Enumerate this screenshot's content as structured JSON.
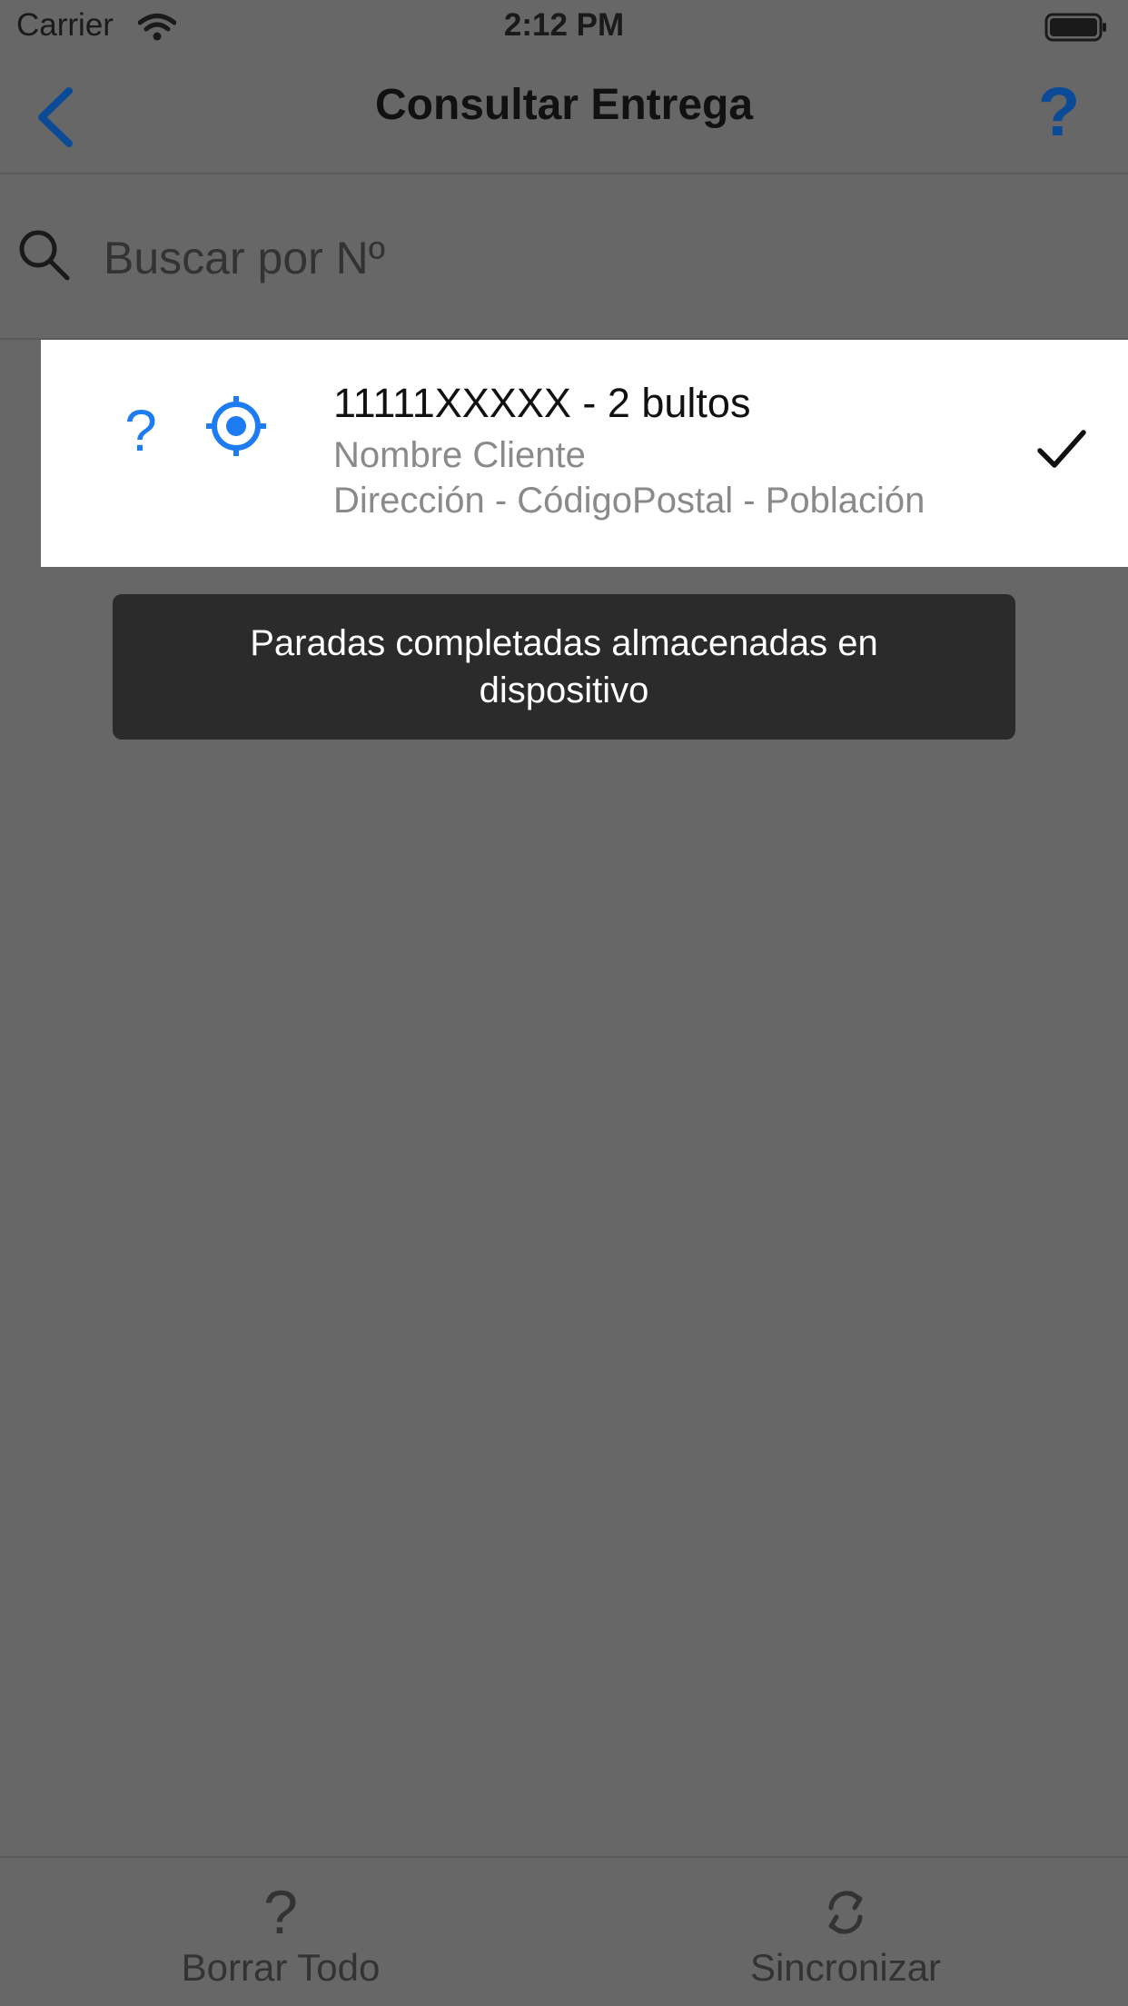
{
  "status_bar": {
    "carrier": "Carrier",
    "time": "2:12 PM",
    "icons": [
      "wifi-icon",
      "battery-icon"
    ]
  },
  "nav": {
    "back_icon": "chevron-left-icon",
    "title": "Consultar Entrega",
    "help_label": "?",
    "accent_color": "#0b4a97"
  },
  "search": {
    "icon": "search-icon",
    "placeholder": "Buscar por Nº",
    "value": ""
  },
  "deliveries": [
    {
      "help_label": "?",
      "locate_icon": "crosshair-icon",
      "title": "11111XXXXX - 2 bultos",
      "client": "Nombre Cliente",
      "address": "Dirección - CódigoPostal - Población",
      "status_icon": "checkmark-icon",
      "icon_color": "#1d7cf2"
    }
  ],
  "toast": {
    "message": "Paradas completadas almacenadas en dispositivo"
  },
  "tab_bar": {
    "clear": {
      "label": "Borrar Todo",
      "icon": "question-icon",
      "glyph": "?"
    },
    "sync": {
      "label": "Sincronizar",
      "icon": "sync-icon"
    }
  },
  "colors": {
    "overlay_background": "#676767",
    "row_background": "#ffffff",
    "toast_background": "#2b2b2b"
  }
}
